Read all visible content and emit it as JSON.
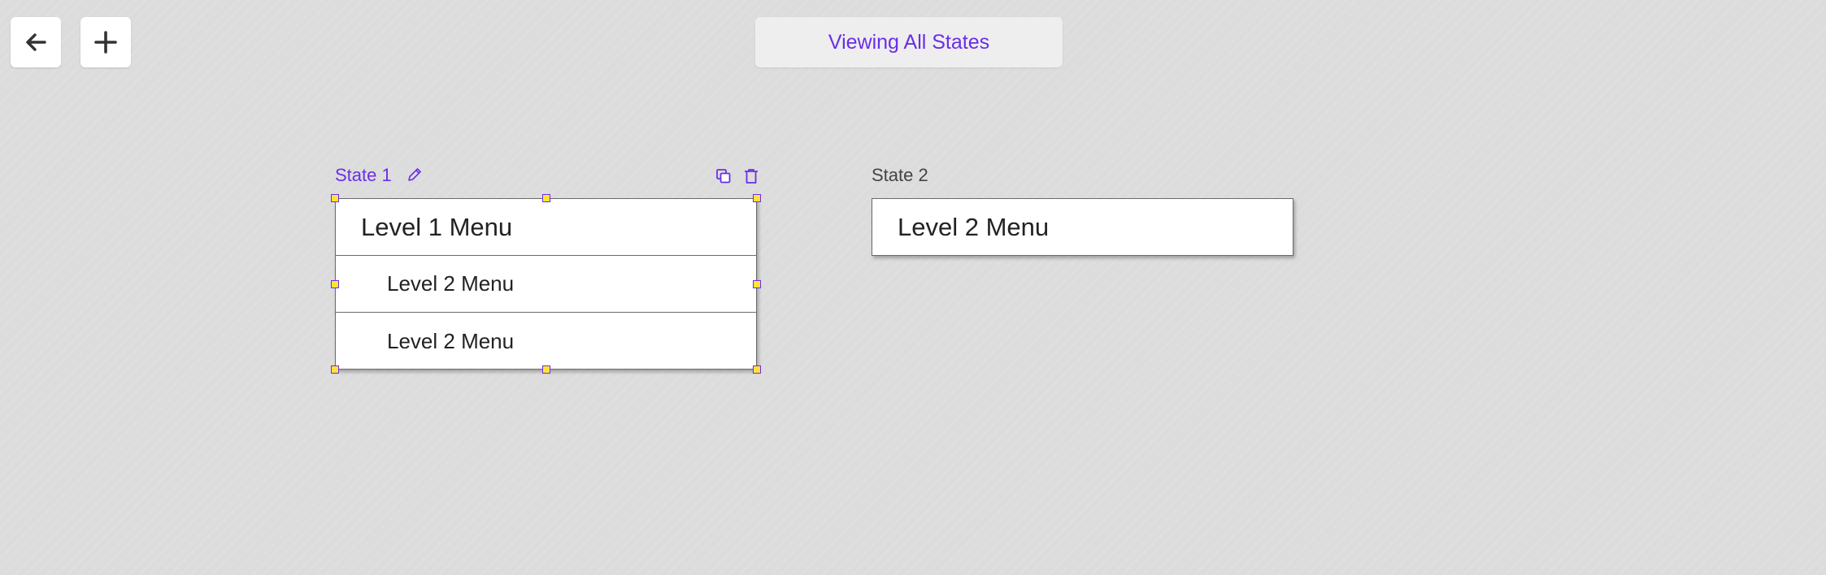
{
  "toolbar": {
    "back_icon": "arrow-left-icon",
    "add_icon": "plus-icon",
    "viewing_label": "Viewing All States"
  },
  "colors": {
    "accent": "#6a2ee8",
    "handle_fill": "#ffe338",
    "canvas": "#dcdcdc"
  },
  "states": [
    {
      "label": "State 1",
      "selected": true,
      "icons": [
        "pencil-icon",
        "copy-icon",
        "trash-icon"
      ],
      "menu": [
        {
          "level": 1,
          "label": "Level 1 Menu"
        },
        {
          "level": 2,
          "label": "Level 2 Menu"
        },
        {
          "level": 2,
          "label": "Level 2 Menu"
        }
      ]
    },
    {
      "label": "State 2",
      "selected": false,
      "menu": [
        {
          "level": 2,
          "label": "Level 2 Menu"
        }
      ]
    }
  ]
}
